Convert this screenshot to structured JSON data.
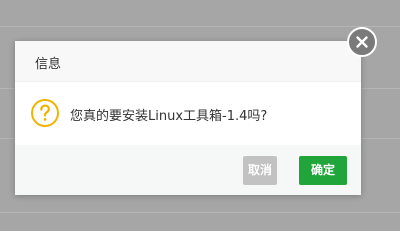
{
  "dialog": {
    "title": "信息",
    "message": "您真的要安装Linux工具箱-1.4吗?",
    "icon": "question-icon",
    "close_icon": "close-icon",
    "buttons": {
      "cancel": "取消",
      "confirm": "确定"
    }
  },
  "colors": {
    "backdrop": "#a6a6a6",
    "confirm": "#20a53a",
    "cancel": "#c2c2c2",
    "question": "#f0b400"
  }
}
